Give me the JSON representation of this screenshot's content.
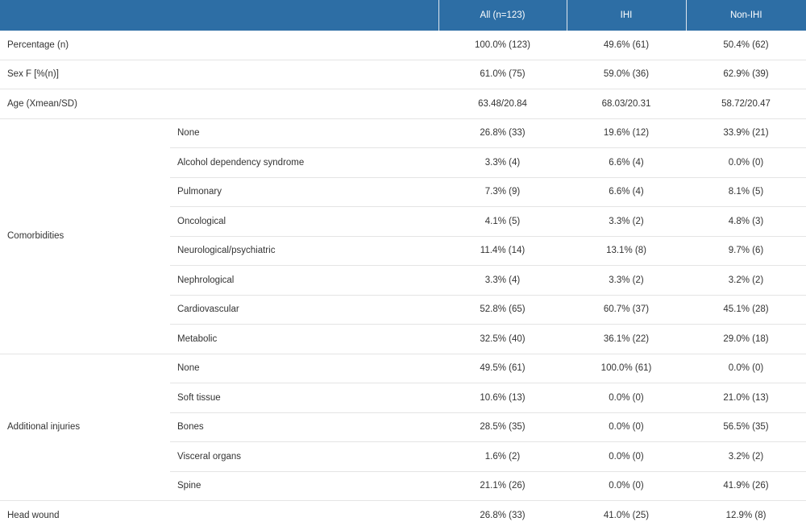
{
  "header": {
    "col1": "",
    "col2": "",
    "col3": "All (n=123)",
    "col4": "IHI",
    "col5": "Non-IHI"
  },
  "rows": {
    "percentage": {
      "label": "Percentage (n)",
      "all": "100.0% (123)",
      "ihi": "49.6% (61)",
      "non": "50.4% (62)"
    },
    "sex": {
      "label": "Sex F [%(n)]",
      "all": "61.0% (75)",
      "ihi": "59.0% (36)",
      "non": "62.9% (39)"
    },
    "age": {
      "label": "Age (Xmean/SD)",
      "all": "63.48/20.84",
      "ihi": "68.03/20.31",
      "non": "58.72/20.47"
    },
    "head_wound": {
      "label": "Head wound",
      "all": "26.8% (33)",
      "ihi": "41.0% (25)",
      "non": "12.9% (8)"
    }
  },
  "comorbidities": {
    "label": "Comorbidities",
    "items": [
      {
        "label": "None",
        "all": "26.8% (33)",
        "ihi": "19.6% (12)",
        "non": "33.9% (21)"
      },
      {
        "label": "Alcohol dependency syndrome",
        "all": "3.3% (4)",
        "ihi": "6.6% (4)",
        "non": "0.0% (0)"
      },
      {
        "label": "Pulmonary",
        "all": "7.3% (9)",
        "ihi": "6.6% (4)",
        "non": "8.1% (5)"
      },
      {
        "label": "Oncological",
        "all": "4.1% (5)",
        "ihi": "3.3% (2)",
        "non": "4.8% (3)"
      },
      {
        "label": "Neurological/psychiatric",
        "all": "11.4% (14)",
        "ihi": "13.1% (8)",
        "non": "9.7% (6)"
      },
      {
        "label": "Nephrological",
        "all": "3.3% (4)",
        "ihi": "3.3% (2)",
        "non": "3.2% (2)"
      },
      {
        "label": "Cardiovascular",
        "all": "52.8% (65)",
        "ihi": "60.7% (37)",
        "non": "45.1% (28)"
      },
      {
        "label": "Metabolic",
        "all": "32.5% (40)",
        "ihi": "36.1% (22)",
        "non": "29.0% (18)"
      }
    ]
  },
  "injuries": {
    "label": "Additional injuries",
    "items": [
      {
        "label": "None",
        "all": "49.5% (61)",
        "ihi": "100.0% (61)",
        "non": "0.0% (0)"
      },
      {
        "label": "Soft tissue",
        "all": "10.6% (13)",
        "ihi": "0.0% (0)",
        "non": "21.0% (13)"
      },
      {
        "label": "Bones",
        "all": "28.5% (35)",
        "ihi": "0.0% (0)",
        "non": "56.5% (35)"
      },
      {
        "label": "Visceral organs",
        "all": "1.6% (2)",
        "ihi": "0.0% (0)",
        "non": "3.2% (2)"
      },
      {
        "label": "Spine",
        "all": "21.1% (26)",
        "ihi": "0.0% (0)",
        "non": "41.9% (26)"
      }
    ]
  },
  "colors": {
    "header_bg": "#2d6ea5",
    "header_text": "#ffffff",
    "row_border": "#e4e4e4"
  }
}
